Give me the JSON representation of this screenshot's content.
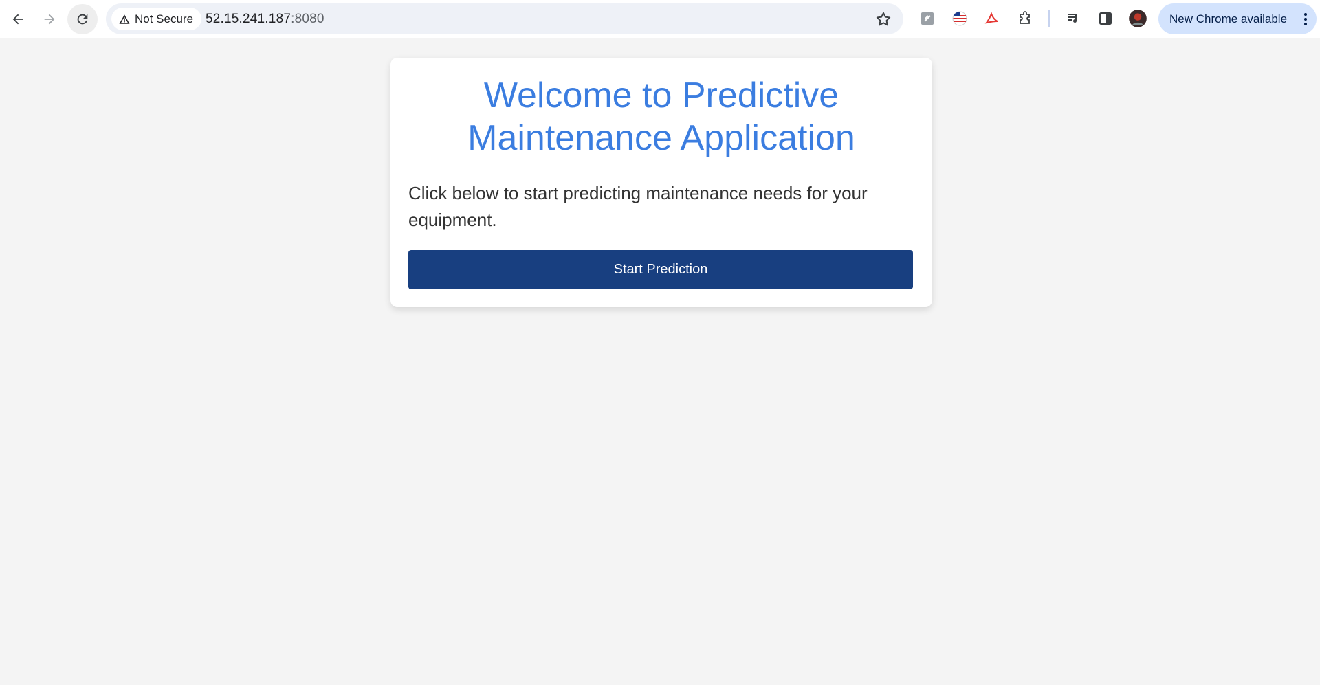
{
  "browser": {
    "security_label": "Not Secure",
    "url_host": "52.15.241.187",
    "url_port": ":8080",
    "update_label": "New Chrome available",
    "icons": [
      "back-arrow-icon",
      "forward-arrow-icon",
      "reload-icon",
      "warning-icon",
      "star-icon",
      "extension-icon",
      "media-controls-icon",
      "side-panel-icon",
      "profile-avatar-icon",
      "kebab-menu-icon"
    ]
  },
  "page": {
    "title": "Welcome to Predictive Maintenance Application",
    "description": "Click below to start predicting maintenance needs for your equipment.",
    "start_button_label": "Start Prediction"
  },
  "colors": {
    "page_background": "#f4f4f4",
    "title": "#3b7de0",
    "button_background": "#183f80",
    "button_text": "#ffffff",
    "update_chip": "#d3e3fd"
  }
}
